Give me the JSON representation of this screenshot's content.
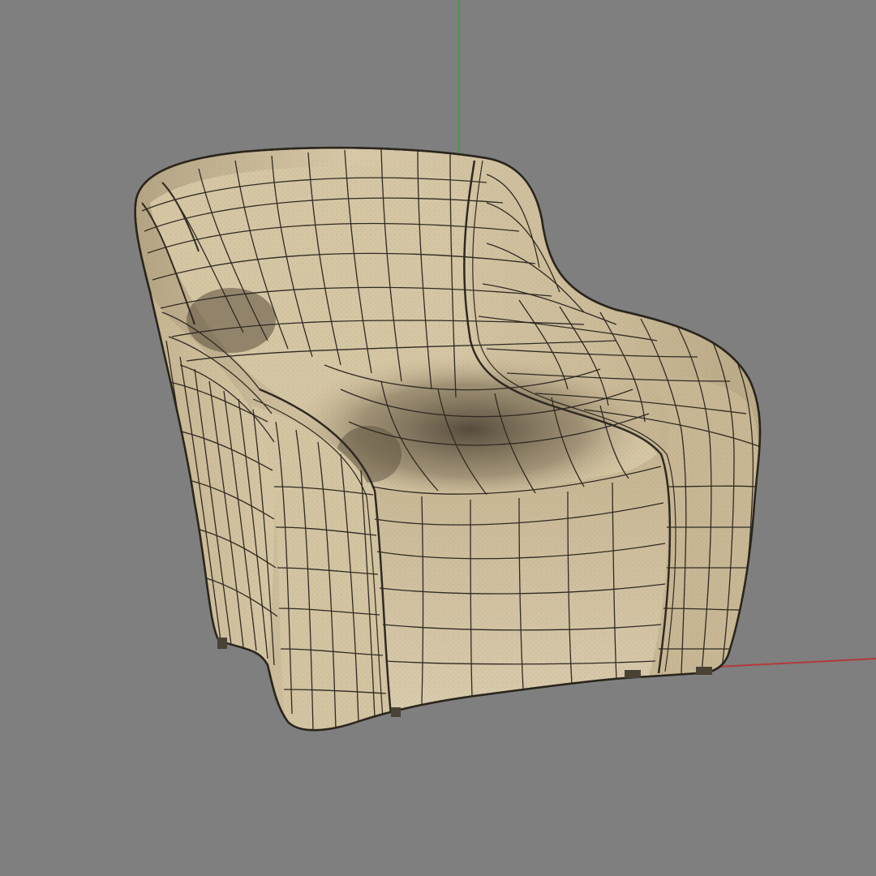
{
  "viewport": {
    "background": "#7f7f7f",
    "mode": "shaded-wireframe"
  },
  "axes": {
    "y_color": "#3aa23a",
    "x_color": "#b33a3a"
  },
  "model": {
    "object": "armchair",
    "surface_color": "#c9b896",
    "shadow_color": "#5b4f3c",
    "wire_color": "#2f2a22"
  }
}
